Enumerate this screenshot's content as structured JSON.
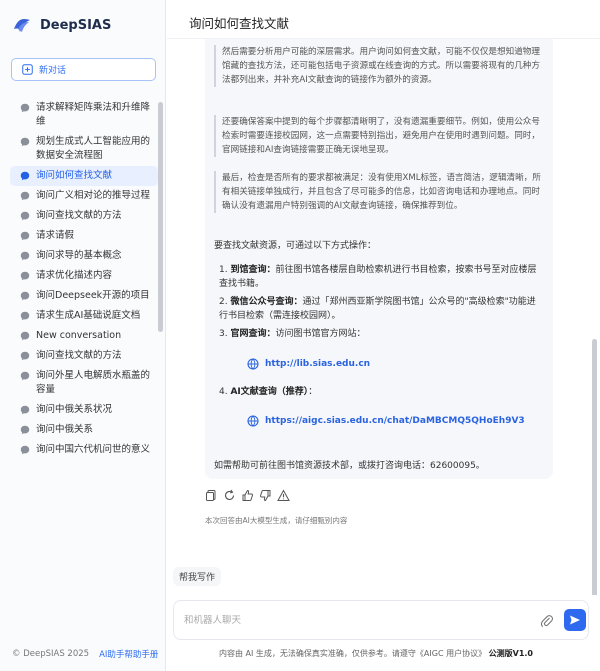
{
  "brand": {
    "name": "DeepSIAS"
  },
  "sidebar": {
    "new_chat": "新对话",
    "items": [
      "请求解释矩阵乘法和升维降维",
      "规划生成式人工智能应用的数据安全流程图",
      "询问如何查找文献",
      "询问广义相对论的推导过程",
      "询问查找文献的方法",
      "请求请假",
      "询问求导的基本概念",
      "请求优化描述内容",
      "询问Deepseek开源的项目",
      "请求生成AI基础说庭文档",
      "New conversation",
      "询问查找文献的方法",
      "询问外星人电解质水瓶盖的容量",
      "询问中俄关系状况",
      "询问中俄关系",
      "询问中国六代机问世的意义"
    ],
    "active_index": 2,
    "footer_copyright": "© DeepSIAS 2025",
    "footer_link": "AI助手帮助手册"
  },
  "main": {
    "title": "询问如何查找文献",
    "quotes": [
      "然后需要分析用户可能的深层需求。用户询问如何查文献，可能不仅仅是想知道物理馆藏的查找方法，还可能包括电子资源或在线查询的方式。所以需要将现有的几种方法都列出来，并补充AI文献查询的链接作为额外的资源。",
      "还要确保答案中提到的每个步骤都清晰明了，没有遗漏重要细节。例如，使用公众号检索时需要连接校园网，这一点需要特别指出，避免用户在使用时遇到问题。同时，官网链接和AI查询链接需要正确无误地呈现。",
      "最后，检查是否所有的要求都被满足：没有使用XML标签，语言简洁，逻辑清晰，所有相关链接单独成行，并且包含了尽可能多的信息，比如咨询电话和办理地点。同时确认没有遗漏用户特别强调的AI文献查询链接，确保推荐到位。"
    ],
    "intro": "要查找文献资源，可通过以下方式操作：",
    "steps": [
      {
        "num": "1.",
        "title": "到馆查询：",
        "text": "前往图书馆各楼层自助检索机进行书目检索，按索书号至对应楼层查找书籍。"
      },
      {
        "num": "2.",
        "title": "微信公众号查询：",
        "text": "通过「郑州西亚斯学院图书馆」公众号的\"高级检索\"功能进行书目检索（需连接校园网）。"
      },
      {
        "num": "3.",
        "title": "官网查询：",
        "text": "访问图书馆官方网站："
      },
      {
        "num": "4.",
        "title": "AI文献查询（推荐）",
        "text": "："
      }
    ],
    "link_official": "http://lib.sias.edu.cn",
    "link_ai": "https://aigc.sias.edu.cn/chat/DaMBCMQ5QHoEh9V3",
    "closing": "如需帮助可前往图书馆资源技术部，或拨打咨询电话：62600095。",
    "ai_disclaimer": "本次回答由AI大模型生成，请仔细甄别内容",
    "quick_action": "帮我写作",
    "input_placeholder": "和机器人聊天",
    "bottom_note": "内容由 AI 生成，无法确保真实准确，仅供参考。请遵守《AIGC 用户协议》",
    "version": "公测版V1.0"
  },
  "colors": {
    "accent": "#2d6af0",
    "active_bg": "#e8efff"
  }
}
